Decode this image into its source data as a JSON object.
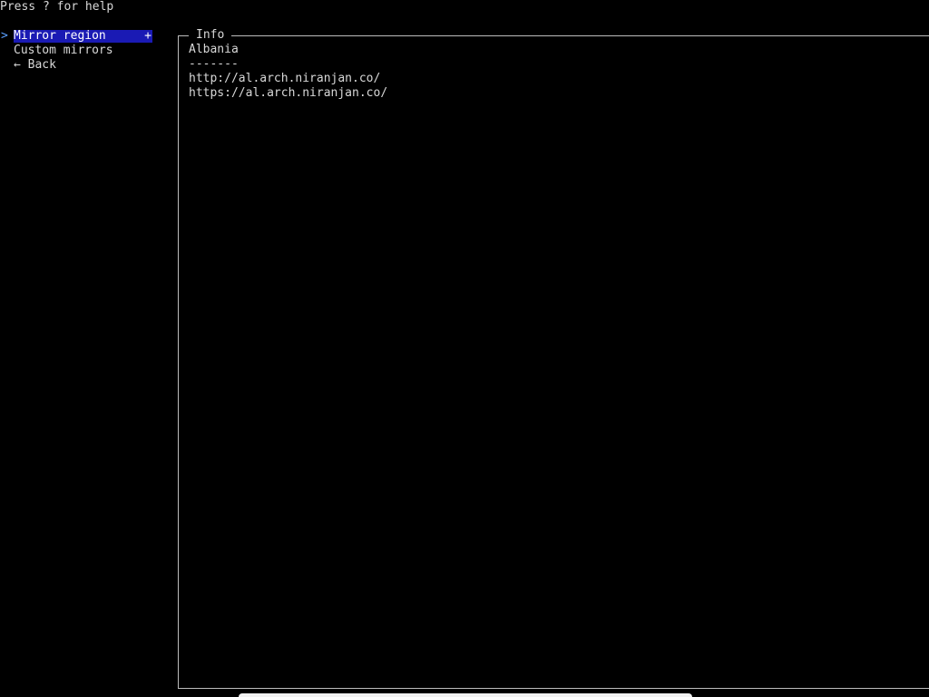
{
  "help_text": "Press ? for help",
  "menu": {
    "items": [
      {
        "label": "Mirror region",
        "marker": "+",
        "selected": true,
        "cursor": ">"
      },
      {
        "label": "Custom mirrors",
        "marker": "",
        "selected": false,
        "cursor": ""
      },
      {
        "label": "← Back",
        "marker": "",
        "selected": false,
        "cursor": ""
      }
    ]
  },
  "info": {
    "title": "Info",
    "region": "Albania",
    "separator": "-------",
    "mirrors": [
      "http://al.arch.niranjan.co/",
      "https://al.arch.niranjan.co/"
    ]
  },
  "colors": {
    "background": "#000000",
    "text": "#d8d8d8",
    "selection": "#1a1ab4",
    "cursor": "#5aa0ff",
    "border": "#bcbcbc"
  }
}
